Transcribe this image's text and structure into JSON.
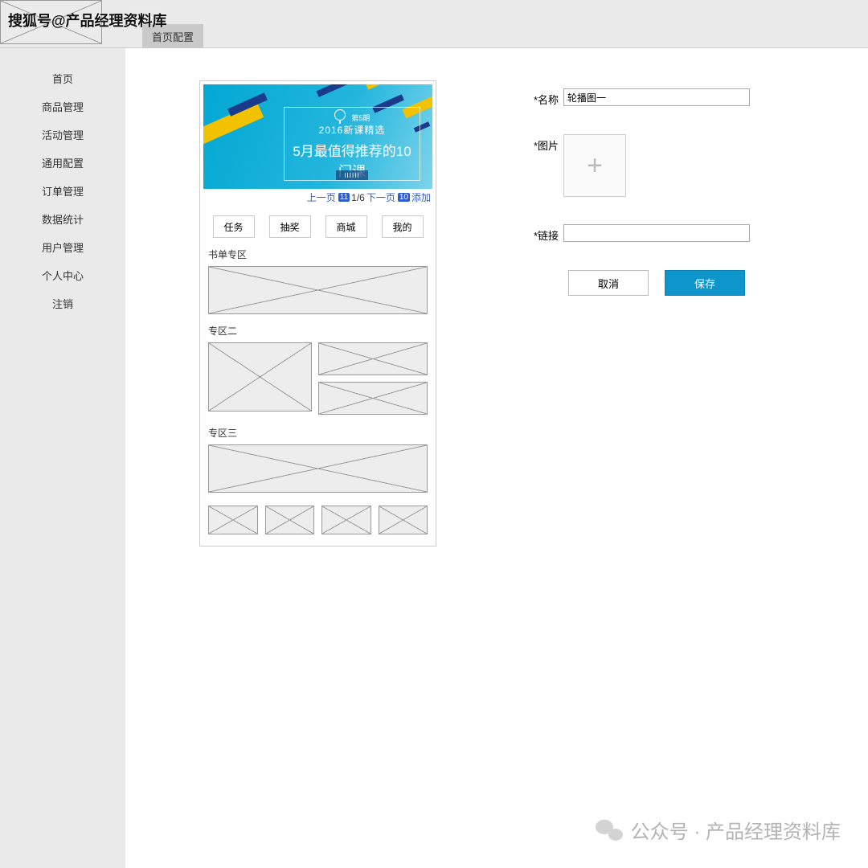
{
  "watermark_top": "搜狐号@产品经理资料库",
  "header": {
    "tab": "首页配置"
  },
  "sidebar": {
    "items": [
      "首页",
      "商品管理",
      "活动管理",
      "通用配置",
      "订单管理",
      "数据统计",
      "用户管理",
      "个人中心",
      "注销"
    ]
  },
  "banner": {
    "sub1": "第5期",
    "sub2": "2016新课精选",
    "title": "5月最值得推荐的10门课",
    "logo_text": "IIIIII"
  },
  "pager": {
    "prev": "上一页",
    "prev_badge": "11",
    "count": "1/6",
    "next": "下一页",
    "next_badge": "10",
    "add": "添加"
  },
  "tabs": [
    "任务",
    "抽奖",
    "商城",
    "我的"
  ],
  "sections": {
    "a": "书单专区",
    "b": "专区二",
    "c": "专区三"
  },
  "form": {
    "name_label": "*名称",
    "name_value": "轮播图一",
    "image_label": "*图片",
    "link_label": "*链接",
    "link_value": "",
    "cancel": "取消",
    "save": "保存"
  },
  "watermark_bottom": "公众号 · 产品经理资料库"
}
